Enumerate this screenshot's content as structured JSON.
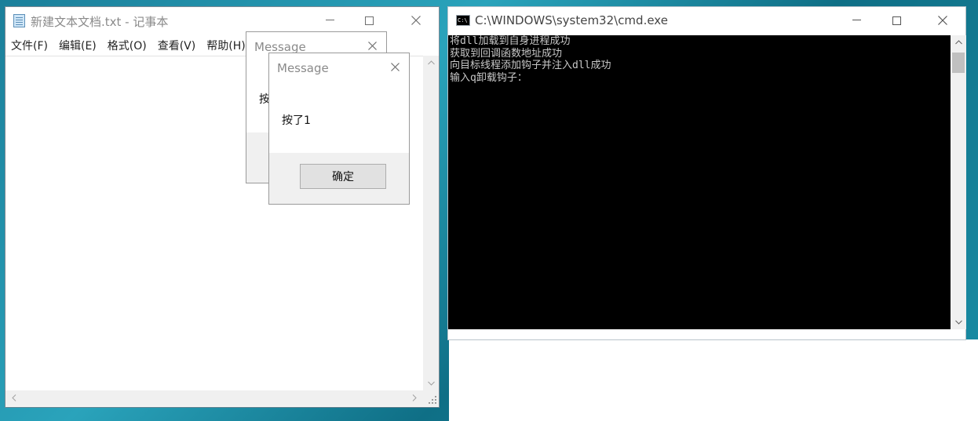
{
  "notepad": {
    "title": "新建文本文档.txt - 记事本",
    "menu": [
      {
        "label": "文件(F)"
      },
      {
        "label": "编辑(E)"
      },
      {
        "label": "格式(O)"
      },
      {
        "label": "查看(V)"
      },
      {
        "label": "帮助(H)"
      }
    ]
  },
  "dialog_back": {
    "title": "Message",
    "text": "按了1"
  },
  "dialog_front": {
    "title": "Message",
    "text": "按了1",
    "ok_label": "确定"
  },
  "cmd": {
    "title": "C:\\WINDOWS\\system32\\cmd.exe",
    "lines": [
      "将dll加载到自身进程成功",
      "获取到回调函数地址成功",
      "向目标线程添加钩子并注入dll成功",
      "输入q卸载钩子："
    ]
  },
  "icons": {
    "window_controls": [
      "minimize-icon",
      "maximize-icon",
      "close-icon"
    ],
    "scroll_arrows": [
      "chevron-up-icon",
      "chevron-down-icon",
      "chevron-left-icon",
      "chevron-right-icon"
    ]
  },
  "colors": {
    "desktop": "#1b7f9a",
    "console_bg": "#000000",
    "console_text": "#c8c8c8",
    "dialog_footer": "#f0f0f0"
  }
}
